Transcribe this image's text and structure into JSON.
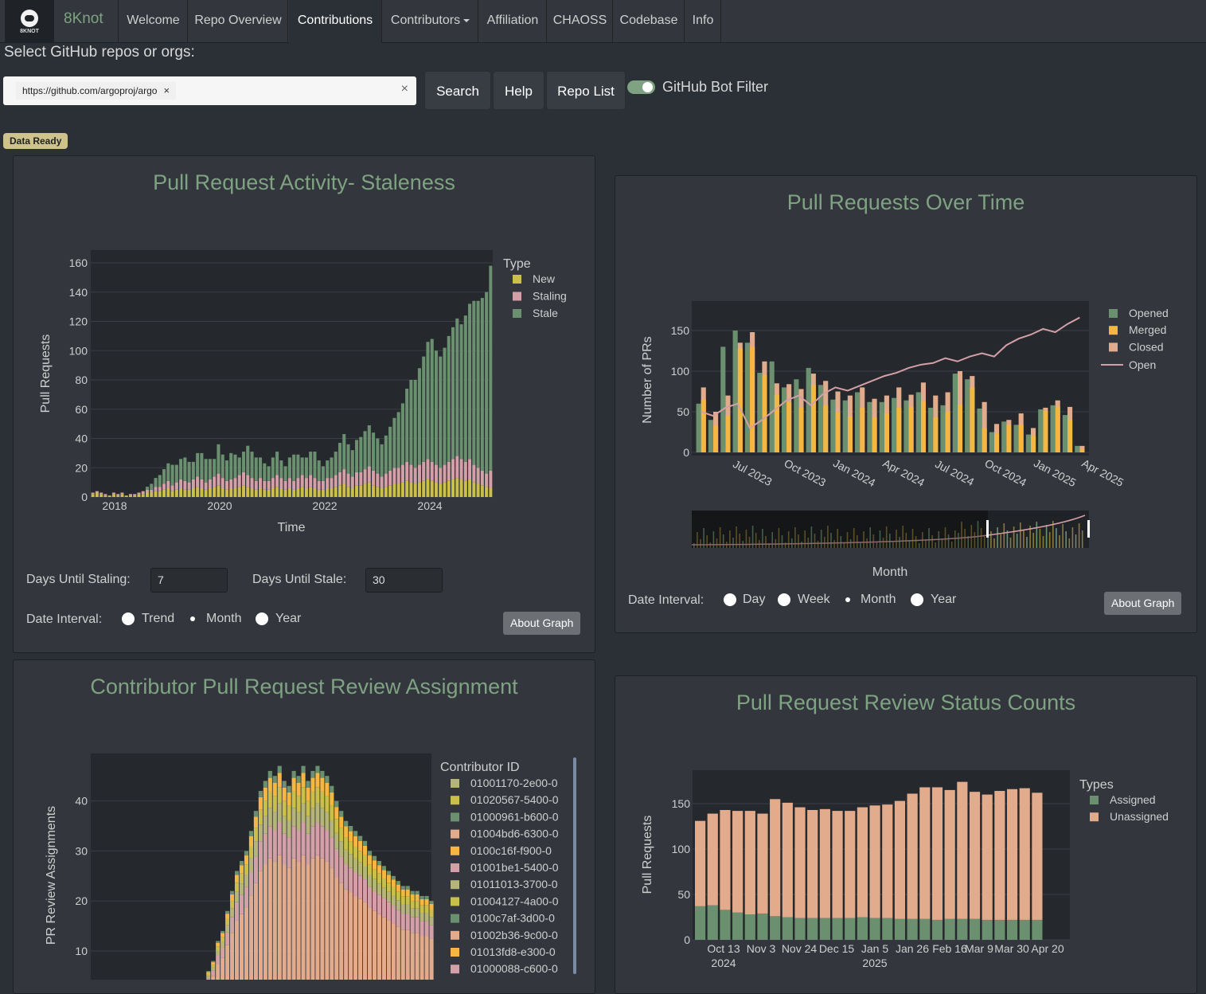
{
  "app": {
    "brand_logo_text": "8KNOT",
    "brand_name": "8Knot",
    "nav": [
      {
        "label": "Welcome"
      },
      {
        "label": "Repo Overview"
      },
      {
        "label": "Contributions",
        "active": true
      },
      {
        "label": "Contributors",
        "dropdown": true
      },
      {
        "label": "Affiliation"
      },
      {
        "label": "CHAOSS"
      },
      {
        "label": "Codebase"
      },
      {
        "label": "Info"
      }
    ]
  },
  "search": {
    "label": "Select GitHub repos or orgs:",
    "chip": "https://github.com/argoproj/argo",
    "chip_remove": "×",
    "clear": "×",
    "search_button": "Search",
    "help_button": "Help",
    "repo_list_button": "Repo List",
    "bot_filter_label": "GitHub Bot Filter",
    "bot_filter_on": true,
    "status_badge": "Data Ready"
  },
  "colors": {
    "accent": "#7ea282",
    "new": "#c9bf4a",
    "staling": "#d4a0a8",
    "stale": "#6a9070",
    "opened": "#6a9070",
    "merged": "#f5b742",
    "closed": "#e2ab8c",
    "open_line": "#d4a0a8",
    "assigned": "#6a9070",
    "unassigned": "#e2ab8c"
  },
  "cards": {
    "staleness": {
      "title": "Pull Request Activity- Staleness",
      "days_until_staling_label": "Days Until Staling:",
      "days_until_staling_value": "7",
      "days_until_stale_label": "Days Until Stale:",
      "days_until_stale_value": "30",
      "date_interval_label": "Date Interval:",
      "interval_options": [
        "Trend",
        "Month",
        "Year"
      ],
      "interval_selected": "Month",
      "about_button": "About Graph"
    },
    "over_time": {
      "title": "Pull Requests Over Time",
      "date_interval_label": "Date Interval:",
      "interval_options": [
        "Day",
        "Week",
        "Month",
        "Year"
      ],
      "interval_selected": "Month",
      "about_button": "About Graph"
    },
    "review_assignment": {
      "title": "Contributor Pull Request Review Assignment"
    },
    "review_status": {
      "title": "Pull Request Review Status Counts"
    }
  },
  "chart_data": [
    {
      "id": "staleness",
      "type": "bar",
      "stacked": true,
      "xlabel": "Time",
      "ylabel": "Pull Requests",
      "ylim": [
        0,
        160
      ],
      "yticks": [
        0,
        20,
        40,
        60,
        80,
        100,
        120,
        140,
        160
      ],
      "xticks": [
        "2018",
        "2020",
        "2022",
        "2024"
      ],
      "legend_title": "Type",
      "legend_position": "top-right",
      "series": [
        {
          "name": "New",
          "color": "#c9bf4a",
          "values": [
            2,
            3,
            2,
            1,
            1,
            2,
            1,
            2,
            1,
            1,
            1,
            2,
            2,
            3,
            3,
            4,
            4,
            5,
            6,
            4,
            5,
            6,
            5,
            5,
            6,
            7,
            6,
            5,
            6,
            7,
            8,
            6,
            5,
            6,
            6,
            7,
            8,
            7,
            6,
            5,
            6,
            5,
            5,
            6,
            7,
            6,
            5,
            6,
            5,
            6,
            7,
            6,
            7,
            6,
            5,
            5,
            6,
            6,
            7,
            8,
            9,
            7,
            6,
            8,
            8,
            9,
            10,
            8,
            7,
            6,
            7,
            8,
            9,
            9,
            10,
            11,
            10,
            9,
            10,
            11,
            12,
            11,
            10,
            9,
            10,
            11,
            12,
            13,
            12,
            11,
            12,
            10,
            9,
            8,
            7,
            6
          ]
        },
        {
          "name": "Staling",
          "color": "#d4a0a8",
          "values": [
            1,
            1,
            1,
            1,
            0,
            1,
            1,
            1,
            0,
            1,
            1,
            1,
            2,
            2,
            2,
            3,
            3,
            4,
            5,
            4,
            5,
            6,
            6,
            5,
            6,
            7,
            6,
            5,
            6,
            7,
            8,
            7,
            6,
            6,
            7,
            8,
            9,
            8,
            7,
            6,
            7,
            6,
            6,
            7,
            8,
            7,
            6,
            7,
            6,
            7,
            8,
            7,
            8,
            7,
            6,
            6,
            7,
            7,
            8,
            9,
            10,
            9,
            8,
            9,
            9,
            10,
            11,
            10,
            9,
            8,
            9,
            10,
            11,
            11,
            12,
            13,
            12,
            11,
            12,
            13,
            14,
            13,
            12,
            11,
            12,
            13,
            14,
            15,
            14,
            13,
            14,
            12,
            11,
            10,
            9,
            12
          ]
        },
        {
          "name": "Stale",
          "color": "#6a9070",
          "values": [
            0,
            0,
            0,
            0,
            0,
            0,
            0,
            0,
            0,
            0,
            0,
            0,
            0,
            2,
            4,
            6,
            8,
            10,
            12,
            14,
            12,
            14,
            16,
            14,
            12,
            16,
            18,
            16,
            14,
            12,
            20,
            16,
            14,
            18,
            16,
            12,
            14,
            20,
            18,
            16,
            14,
            12,
            10,
            14,
            16,
            12,
            10,
            14,
            18,
            16,
            12,
            14,
            16,
            18,
            14,
            10,
            12,
            14,
            16,
            20,
            24,
            20,
            18,
            22,
            24,
            26,
            28,
            26,
            24,
            22,
            26,
            30,
            34,
            38,
            42,
            50,
            58,
            60,
            66,
            72,
            80,
            84,
            78,
            76,
            80,
            86,
            90,
            94,
            92,
            100,
            106,
            112,
            114,
            118,
            124,
            140
          ]
        }
      ]
    },
    {
      "id": "over_time",
      "type": "bar",
      "xlabel": "Month",
      "ylabel": "Number of PRs",
      "ylim": [
        0,
        190
      ],
      "yticks": [
        0,
        50,
        100,
        150
      ],
      "xticks": [
        "Jul 2023",
        "Oct 2023",
        "Jan 2024",
        "Apr 2024",
        "Jul 2024",
        "Oct 2024",
        "Jan 2025",
        "Apr 2025"
      ],
      "legend_position": "top-right",
      "series": [
        {
          "name": "Opened",
          "color": "#6a9070",
          "values": [
            60,
            40,
            130,
            150,
            135,
            98,
            112,
            80,
            90,
            104,
            83,
            65,
            64,
            74,
            62,
            62,
            67,
            64,
            74,
            55,
            58,
            97,
            90,
            54,
            25,
            38,
            34,
            22,
            53,
            58,
            46,
            8
          ]
        },
        {
          "name": "Merged",
          "color": "#f5b742",
          "values": [
            65,
            33,
            45,
            128,
            130,
            95,
            71,
            62,
            55,
            83,
            58,
            49,
            44,
            55,
            43,
            48,
            55,
            56,
            63,
            43,
            50,
            59,
            80,
            30,
            23,
            34,
            34,
            20,
            51,
            56,
            40,
            4
          ]
        },
        {
          "name": "Closed",
          "color": "#e2ab8c",
          "values": [
            80,
            50,
            70,
            135,
            148,
            112,
            85,
            84,
            78,
            97,
            88,
            75,
            70,
            80,
            66,
            70,
            80,
            71,
            86,
            70,
            74,
            100,
            94,
            62,
            35,
            40,
            48,
            30,
            55,
            64,
            56,
            8
          ]
        }
      ],
      "line": {
        "name": "Open",
        "color": "#d4a0a8",
        "values": [
          50,
          45,
          55,
          60,
          30,
          40,
          52,
          64,
          70,
          58,
          72,
          80,
          76,
          82,
          88,
          94,
          98,
          104,
          108,
          110,
          116,
          112,
          118,
          122,
          118,
          132,
          140,
          145,
          152,
          148,
          158,
          166
        ]
      }
    },
    {
      "id": "review_assignment",
      "type": "bar",
      "stacked": true,
      "ylabel": "PR Review Assignments",
      "ylim": [
        0,
        50
      ],
      "yticks": [
        10,
        20,
        30,
        40
      ],
      "legend_title": "Contributor ID",
      "legend_position": "right",
      "series": [
        {
          "name": "01001170-2e00-0",
          "color": "#b5b57a"
        },
        {
          "name": "01020567-5400-0",
          "color": "#c9bf4a"
        },
        {
          "name": "01000961-b600-0",
          "color": "#6a9070"
        },
        {
          "name": "01004bd6-6300-0",
          "color": "#e2ab8c"
        },
        {
          "name": "0100c16f-f900-0",
          "color": "#f5b742"
        },
        {
          "name": "01001be1-5400-0",
          "color": "#d4a0a8"
        },
        {
          "name": "01011013-3700-0",
          "color": "#b5b57a"
        },
        {
          "name": "01004127-4a00-0",
          "color": "#c9bf4a"
        },
        {
          "name": "0100c7af-3d00-0",
          "color": "#6a9070"
        },
        {
          "name": "01002b36-9c00-0",
          "color": "#e2ab8c"
        },
        {
          "name": "01013fd8-e300-0",
          "color": "#f5b742"
        },
        {
          "name": "01000088-c600-0",
          "color": "#d4a0a8"
        }
      ],
      "totals": [
        1,
        2,
        2,
        3,
        4,
        6,
        8,
        12,
        14,
        18,
        22,
        26,
        28,
        30,
        34,
        38,
        42,
        44,
        46,
        45,
        47,
        44,
        43,
        46,
        45,
        47,
        44,
        46,
        47,
        46,
        45,
        43,
        40,
        38,
        36,
        35,
        34,
        33,
        32,
        30,
        29,
        28,
        27,
        26,
        25,
        24,
        23,
        23,
        22,
        22,
        21,
        21,
        20
      ]
    },
    {
      "id": "review_status",
      "type": "bar",
      "stacked": true,
      "ylabel": "Pull Requests",
      "ylim": [
        0,
        170
      ],
      "yticks": [
        0,
        50,
        100,
        150
      ],
      "xticks": [
        "Oct 13 2024",
        "Nov 3",
        "Nov 24",
        "Dec 15",
        "Jan 5 2025",
        "Jan 26",
        "Feb 16",
        "Mar 9",
        "Mar 30",
        "Apr 20"
      ],
      "legend_title": "Types",
      "legend_position": "top-right",
      "series": [
        {
          "name": "Assigned",
          "color": "#6a9070",
          "values": [
            37,
            38,
            33,
            30,
            28,
            29,
            26,
            25,
            24,
            24,
            24,
            24,
            24,
            25,
            24,
            24,
            23,
            23,
            23,
            22,
            23,
            23,
            23,
            22,
            22,
            22,
            22,
            22
          ]
        },
        {
          "name": "Unassigned",
          "color": "#e2ab8c",
          "values": [
            94,
            101,
            110,
            112,
            114,
            110,
            129,
            126,
            122,
            119,
            120,
            118,
            118,
            121,
            124,
            125,
            130,
            138,
            145,
            146,
            142,
            151,
            140,
            138,
            142,
            144,
            145,
            140
          ]
        }
      ]
    }
  ]
}
